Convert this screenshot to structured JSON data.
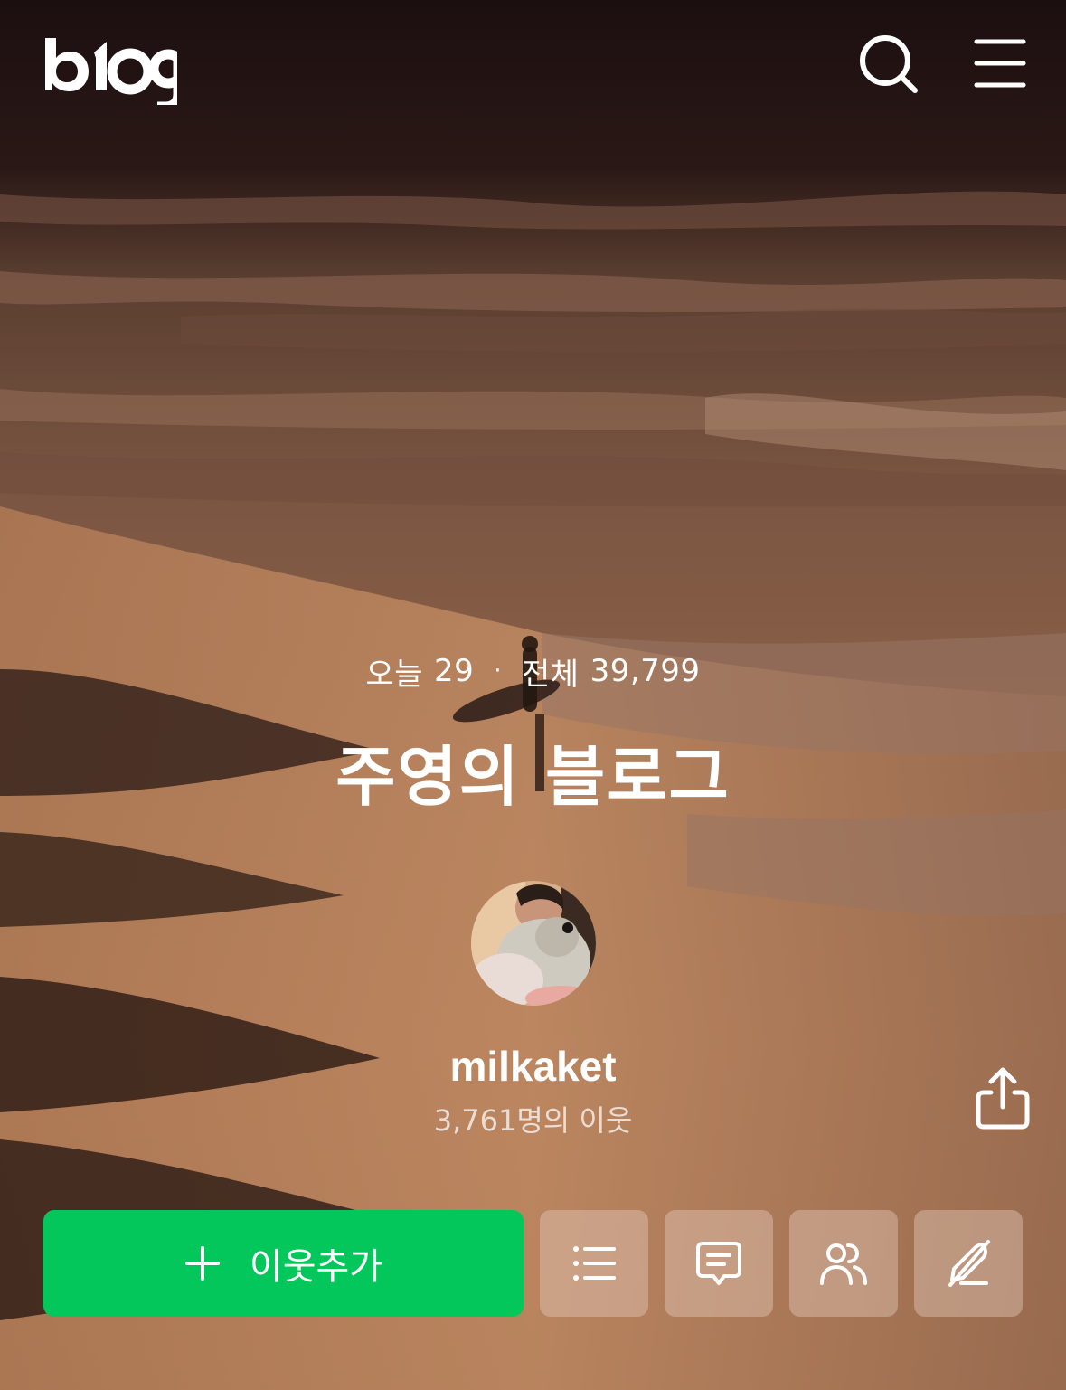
{
  "header": {
    "logo_text": "blog",
    "search_icon": "search-icon",
    "menu_icon": "hamburger-menu-icon"
  },
  "stats": {
    "today_label": "오늘",
    "today_count": "29",
    "separator": "·",
    "total_label": "전체",
    "total_count": "39,799"
  },
  "blog": {
    "title": "주영의 블로그",
    "username": "milkaket",
    "neighbors": "3,761명의 이웃"
  },
  "actions": {
    "add_neighbor_label": "이웃추가",
    "add_icon": "plus-icon",
    "buttons": [
      {
        "icon": "list-icon"
      },
      {
        "icon": "comment-icon"
      },
      {
        "icon": "neighbors-icon"
      },
      {
        "icon": "write-disabled-icon"
      }
    ],
    "share_icon": "share-icon"
  },
  "colors": {
    "brand_green": "#03c75a",
    "text": "#ffffff",
    "button_translucent": "rgba(232,205,190,0.42)"
  }
}
